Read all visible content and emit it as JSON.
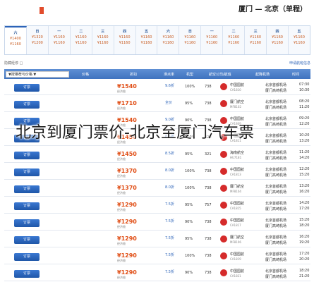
{
  "route_title": "厦门 — 北京（单程）",
  "overlay_title": "北京到厦门票价-北京至厦门汽车票",
  "top_tabs": [
    "",
    "",
    "",
    "",
    ""
  ],
  "date_strip": [
    {
      "weekday": "六",
      "price": "¥1400",
      "sub": "¥1160"
    },
    {
      "weekday": "日",
      "price": "¥1320",
      "sub": "¥1200"
    },
    {
      "weekday": "一",
      "price": "¥1160",
      "sub": "¥1160"
    },
    {
      "weekday": "二",
      "price": "¥1160",
      "sub": "¥1160"
    },
    {
      "weekday": "三",
      "price": "¥1160",
      "sub": "¥1160"
    },
    {
      "weekday": "四",
      "price": "¥1160",
      "sub": "¥1160"
    },
    {
      "weekday": "五",
      "price": "¥1160",
      "sub": "¥1160"
    },
    {
      "weekday": "六",
      "price": "¥1160",
      "sub": "¥1160"
    },
    {
      "weekday": "日",
      "price": "¥1160",
      "sub": "¥1160"
    },
    {
      "weekday": "一",
      "price": "¥1160",
      "sub": "¥1160"
    },
    {
      "weekday": "二",
      "price": "¥1160",
      "sub": "¥1160"
    },
    {
      "weekday": "三",
      "price": "¥1160",
      "sub": "¥1160"
    },
    {
      "weekday": "四",
      "price": "¥1160",
      "sub": "¥1160"
    },
    {
      "weekday": "五",
      "price": "¥1160",
      "sub": "¥1160"
    }
  ],
  "filter": {
    "left": "隐藏经停 □",
    "right": "申请航班信息"
  },
  "table_header": {
    "sort_label": "▼按推荐与价格 ▼",
    "cols": [
      "价格",
      "折扣",
      "准点率",
      "机型",
      "航空公司/航班",
      "起降机场",
      "时间"
    ]
  },
  "rows": [
    {
      "book": "订票",
      "price": "¥1540",
      "price_note": "经济舱",
      "discount": "9.6折",
      "discount_note": "",
      "rate": "100%",
      "craft": "738",
      "flight": "中国国航",
      "flight_no": "CA1810",
      "from": "北京首都机场",
      "to": "厦门高崎机场",
      "t_dep": "07:30",
      "t_arr": "10:30"
    },
    {
      "book": "订票",
      "price": "¥1710",
      "price_note": "经济舱",
      "discount": "全价",
      "discount_note": "",
      "rate": "95%",
      "craft": "738",
      "flight": "厦门航空",
      "flight_no": "MF8102",
      "from": "北京首都机场",
      "to": "厦门高崎机场",
      "t_dep": "08:20",
      "t_arr": "11:20"
    },
    {
      "book": "订票",
      "price": "¥1540",
      "price_note": "经济舱",
      "discount": "9.0折",
      "discount_note": "",
      "rate": "90%",
      "craft": "738",
      "flight": "中国国航",
      "flight_no": "CA1809",
      "from": "北京首都机场",
      "to": "厦门高崎机场",
      "t_dep": "09:20",
      "t_arr": "12:20"
    },
    {
      "book": "订票",
      "price": "¥1450",
      "price_note": "经济舱",
      "discount": "8.5折",
      "discount_note": "",
      "rate": "100%",
      "craft": "320",
      "flight": "中国国航",
      "flight_no": "CA1811",
      "from": "北京首都机场",
      "to": "厦门高崎机场",
      "t_dep": "10:20",
      "t_arr": "13:20"
    },
    {
      "book": "订票",
      "price": "¥1450",
      "price_note": "经济舱",
      "discount": "8.5折",
      "discount_note": "",
      "rate": "95%",
      "craft": "321",
      "flight": "海南航空",
      "flight_no": "HU7181",
      "from": "北京首都机场",
      "to": "厦门高崎机场",
      "t_dep": "11:20",
      "t_arr": "14:20"
    },
    {
      "book": "订票",
      "price": "¥1370",
      "price_note": "经济舱",
      "discount": "8.0折",
      "discount_note": "",
      "rate": "100%",
      "craft": "738",
      "flight": "中国国航",
      "flight_no": "CA1813",
      "from": "北京首都机场",
      "to": "厦门高崎机场",
      "t_dep": "12:20",
      "t_arr": "15:20"
    },
    {
      "book": "订票",
      "price": "¥1370",
      "price_note": "经济舱",
      "discount": "8.0折",
      "discount_note": "",
      "rate": "100%",
      "craft": "738",
      "flight": "厦门航空",
      "flight_no": "MF8104",
      "from": "北京首都机场",
      "to": "厦门高崎机场",
      "t_dep": "13:20",
      "t_arr": "16:20"
    },
    {
      "book": "订票",
      "price": "¥1290",
      "price_note": "经济舱",
      "discount": "7.5折",
      "discount_note": "",
      "rate": "95%",
      "craft": "757",
      "flight": "中国国航",
      "flight_no": "CA1815",
      "from": "北京首都机场",
      "to": "厦门高崎机场",
      "t_dep": "14:20",
      "t_arr": "17:20"
    },
    {
      "book": "订票",
      "price": "¥1290",
      "price_note": "经济舱",
      "discount": "7.5折",
      "discount_note": "",
      "rate": "90%",
      "craft": "738",
      "flight": "中国国航",
      "flight_no": "CA1817",
      "from": "北京首都机场",
      "to": "厦门高崎机场",
      "t_dep": "15:20",
      "t_arr": "18:20"
    },
    {
      "book": "订票",
      "price": "¥1290",
      "price_note": "经济舱",
      "discount": "7.5折",
      "discount_note": "",
      "rate": "95%",
      "craft": "738",
      "flight": "厦门航空",
      "flight_no": "MF8106",
      "from": "北京首都机场",
      "to": "厦门高崎机场",
      "t_dep": "16:20",
      "t_arr": "19:20"
    },
    {
      "book": "订票",
      "price": "¥1290",
      "price_note": "经济舱",
      "discount": "7.5折",
      "discount_note": "",
      "rate": "100%",
      "craft": "738",
      "flight": "中国国航",
      "flight_no": "CA1819",
      "from": "北京首都机场",
      "to": "厦门高崎机场",
      "t_dep": "17:20",
      "t_arr": "20:20"
    },
    {
      "book": "订票",
      "price": "¥1290",
      "price_note": "经济舱",
      "discount": "7.5折",
      "discount_note": "",
      "rate": "90%",
      "craft": "738",
      "flight": "中国国航",
      "flight_no": "CA1821",
      "from": "北京首都机场",
      "to": "厦门高崎机场",
      "t_dep": "18:20",
      "t_arr": "21:20"
    }
  ],
  "colors": {
    "header_blue": "#3f73bf",
    "book_blue": "#1f56a8",
    "price_orange": "#e04d14"
  }
}
